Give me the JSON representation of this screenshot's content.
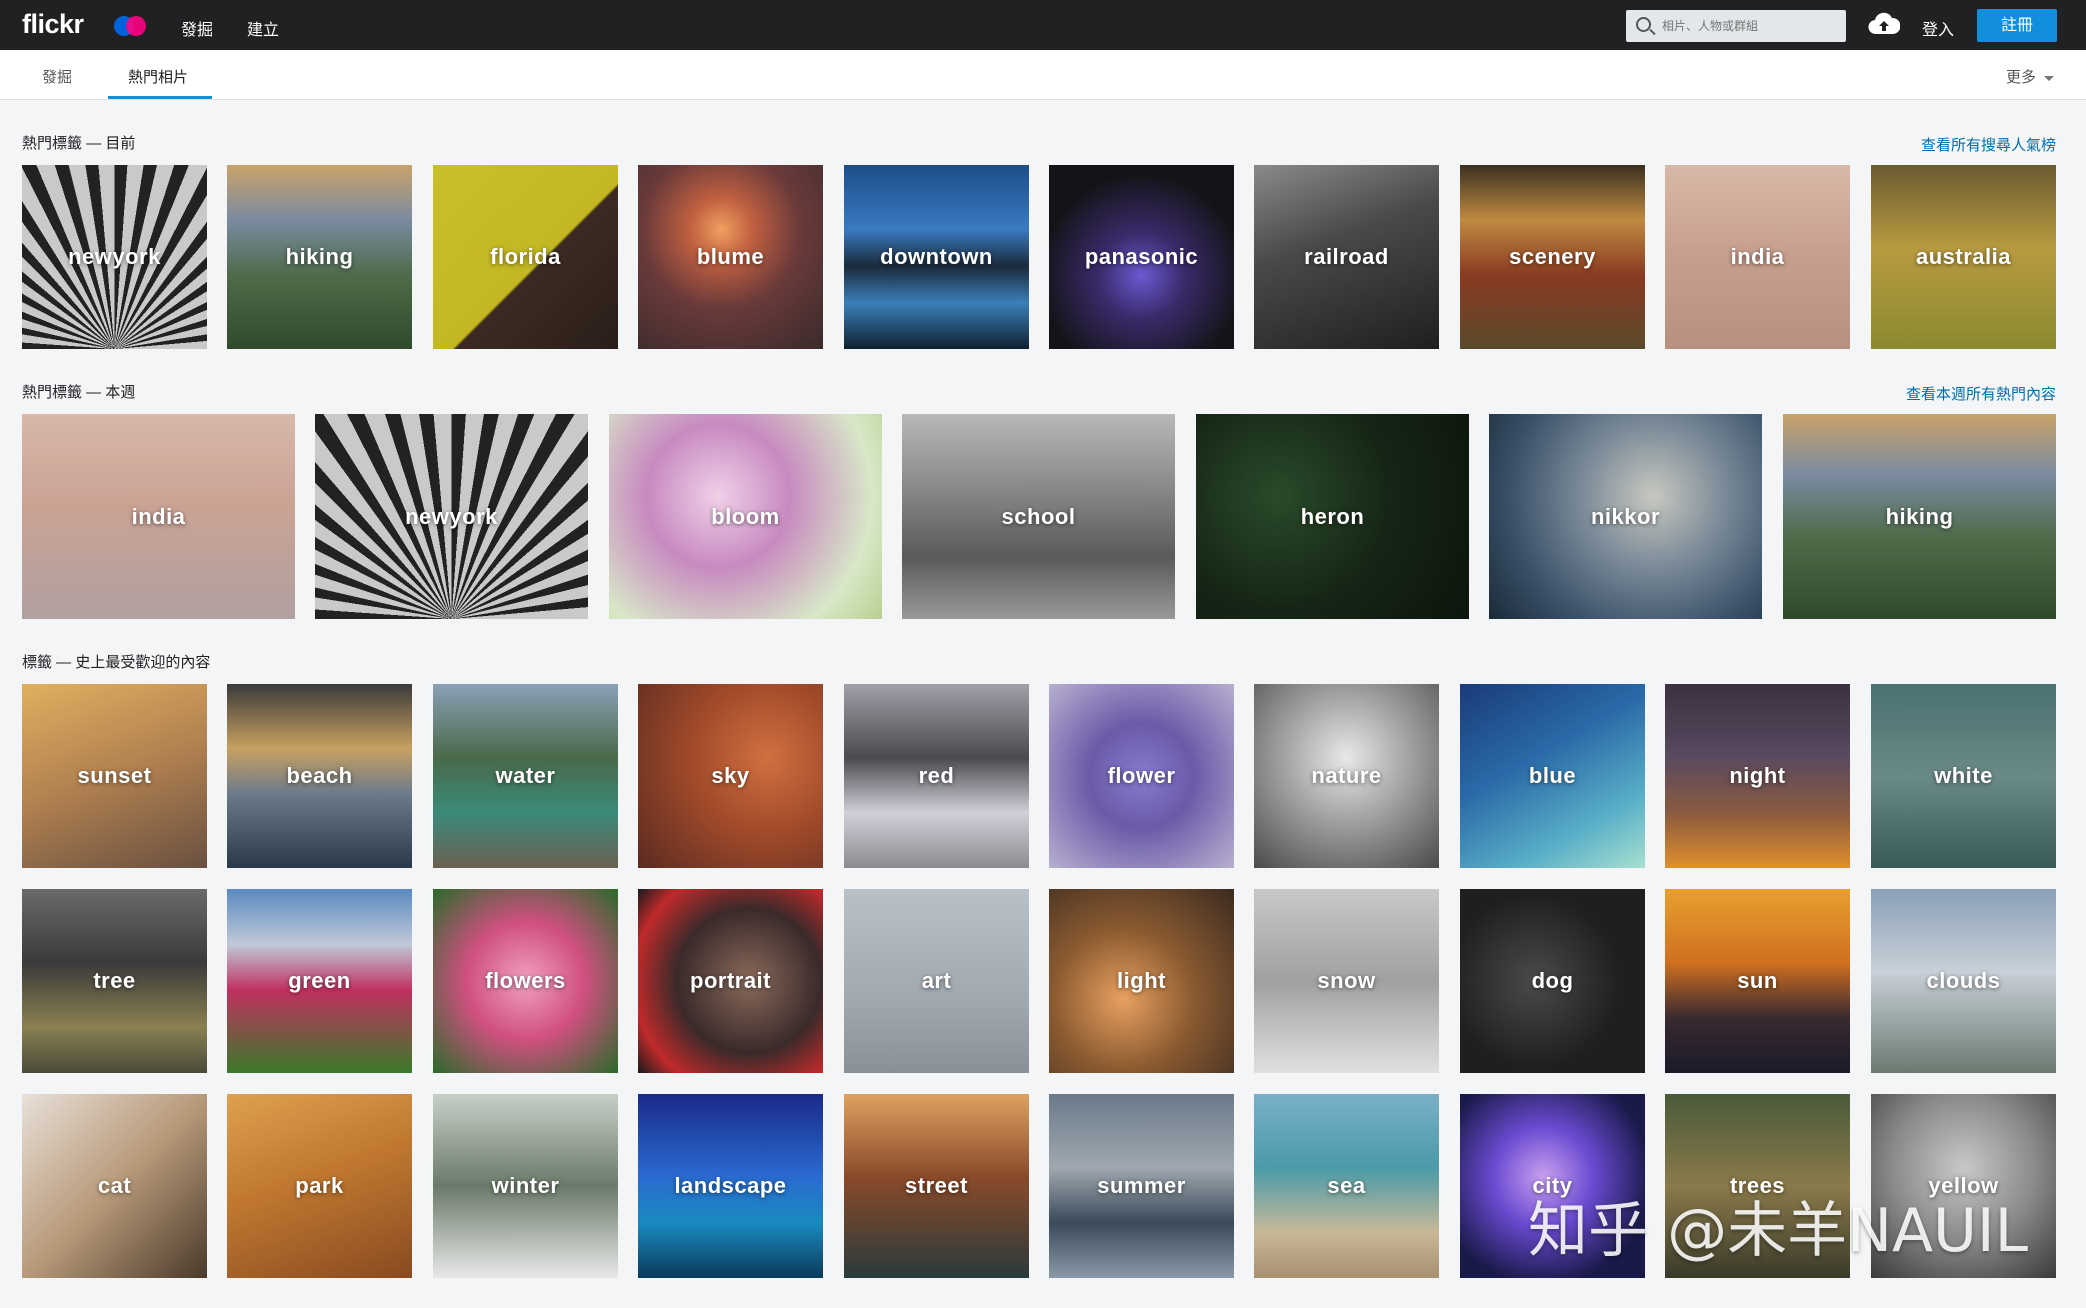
{
  "header": {
    "logo": "flickr",
    "nav": [
      "發掘",
      "建立"
    ],
    "search_placeholder": "相片、人物或群組",
    "signin_label": "登入",
    "signup_label": "註冊"
  },
  "subnav": {
    "tabs": [
      "發掘",
      "熱門相片"
    ],
    "active_tab": "熱門相片",
    "more_label": "更多"
  },
  "sections": {
    "now": {
      "title": "熱門標籤 — 目前",
      "link": "查看所有搜尋人氣榜",
      "tags": [
        "newyork",
        "hiking",
        "florida",
        "blume",
        "downtown",
        "panasonic",
        "railroad",
        "scenery",
        "india",
        "australia"
      ]
    },
    "week": {
      "title": "熱門標籤 — 本週",
      "link": "查看本週所有熱門內容",
      "tags": [
        "india",
        "newyork",
        "bloom",
        "school",
        "heron",
        "nikkor",
        "hiking"
      ]
    },
    "alltime": {
      "title": "標籤 — 史上最受歡迎的內容",
      "tags": [
        "sunset",
        "beach",
        "water",
        "sky",
        "red",
        "flower",
        "nature",
        "blue",
        "night",
        "white",
        "tree",
        "green",
        "flowers",
        "portrait",
        "art",
        "light",
        "snow",
        "dog",
        "sun",
        "clouds",
        "cat",
        "park",
        "winter",
        "landscape",
        "street",
        "summer",
        "sea",
        "city",
        "trees",
        "yellow"
      ]
    }
  },
  "watermark": "知乎 @未羊NAUIL",
  "colors": {
    "accent": "#128fdc",
    "link": "#006dac",
    "topbar": "#212124"
  }
}
